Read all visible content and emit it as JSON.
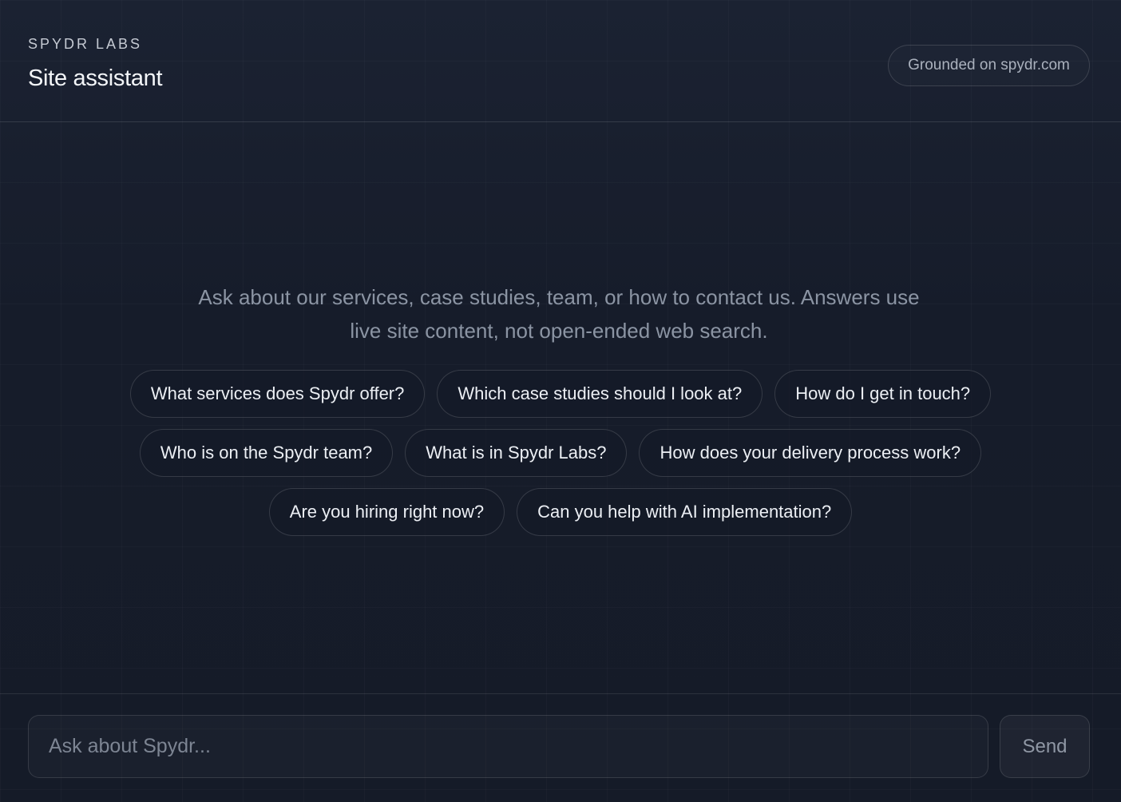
{
  "header": {
    "brand": "SPYDR LABS",
    "title": "Site assistant",
    "grounded_badge": "Grounded on spydr.com"
  },
  "intro": {
    "line1": "Ask about our services, case studies, team, or how to contact us. Answers use",
    "line2": "live site content, not open-ended web search."
  },
  "suggestions": {
    "row1": [
      "What services does Spydr offer?",
      "Which case studies should I look at?",
      "How do I get in touch?"
    ],
    "row2": [
      "Who is on the Spydr team?",
      "What is in Spydr Labs?",
      "How does your delivery process work?"
    ],
    "row3": [
      "Are you hiring right now?",
      "Can you help with AI implementation?"
    ]
  },
  "composer": {
    "placeholder": "Ask about Spydr...",
    "value": "",
    "send_label": "Send"
  },
  "colors": {
    "background": "#161c2a",
    "text_primary": "#eceff4",
    "text_muted": "#8b94a3",
    "border": "#2e3544"
  }
}
